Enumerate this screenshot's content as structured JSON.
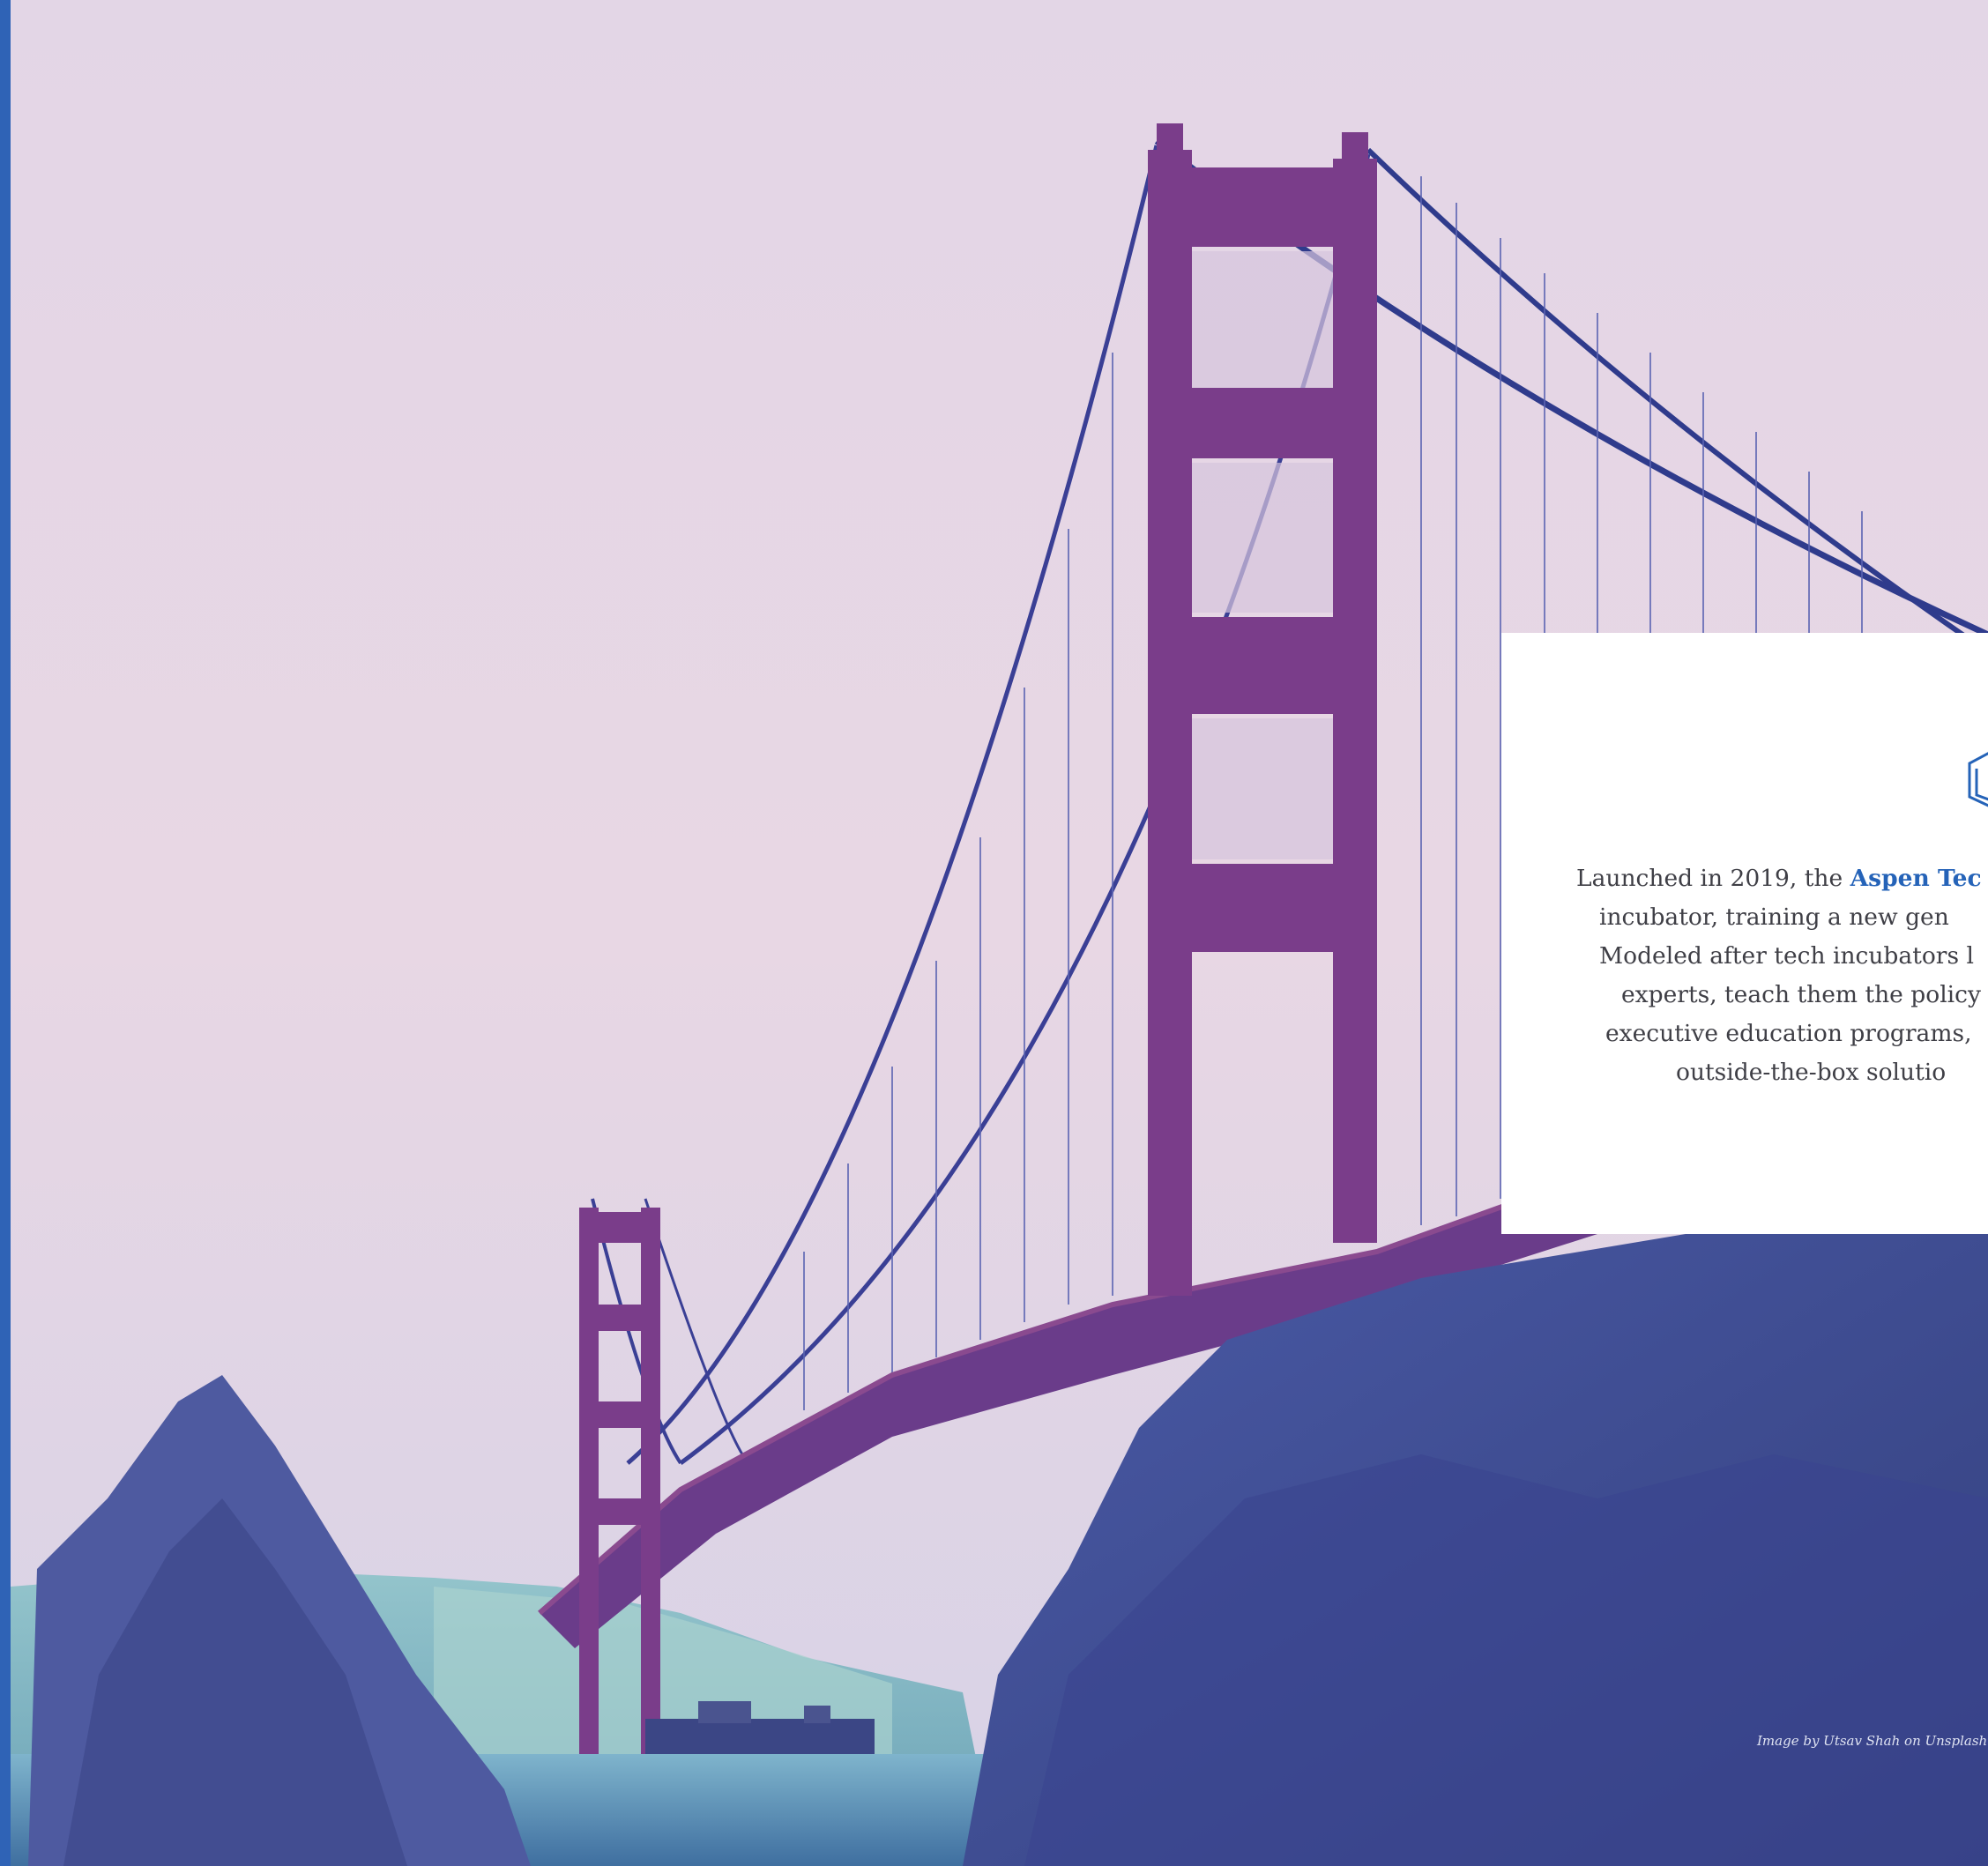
{
  "card": {
    "line1_prefix": "Launched in 2019, the ",
    "line1_link": "Aspen Tec",
    "line2": "incubator, training a new gen",
    "line3": "Modeled after tech incubators l",
    "line4": "experts, teach them the policy",
    "line5": "executive education programs,",
    "line6": "outside-the-box solutio"
  },
  "photo": {
    "credit": "Image by Utsav Shah on Unsplash"
  },
  "colors": {
    "accent_blue": "#2563b8",
    "left_strip": "#2f63b6",
    "bridge_red": "#7a3d8a"
  },
  "icons": {
    "card_logo": "hexagon-logo-icon"
  }
}
